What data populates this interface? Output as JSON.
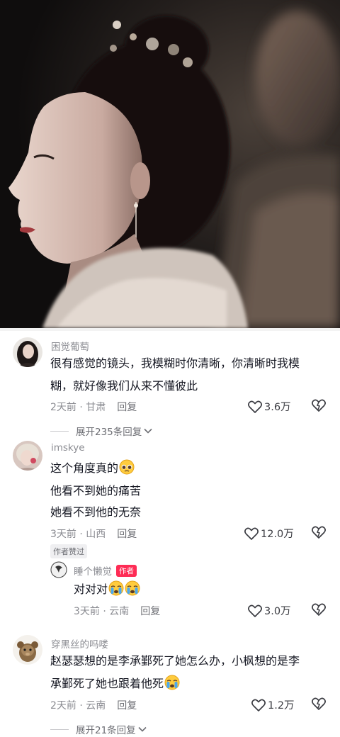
{
  "comments": [
    {
      "username": "困觉葡萄",
      "line1": "很有感觉的镜头，我模糊时你清晰，你清晰时我模",
      "line2": "糊，就好像我们从来不懂彼此",
      "time": "2天前 · 甘肃",
      "reply_label": "回复",
      "likes": "3.6万",
      "expand_label": "展开235条回复"
    },
    {
      "username": "imskye",
      "line1": "这个角度真的",
      "line2": "他看不到她的痛苦",
      "line3": "她看不到他的无奈",
      "time": "3天前 · 山西",
      "reply_label": "回复",
      "likes": "12.0万",
      "author_liked": "作者赞过"
    },
    {
      "username": "睡个懒觉",
      "author_tag": "作者",
      "text": "对对对",
      "time": "3天前 · 云南",
      "reply_label": "回复",
      "likes": "3.0万"
    },
    {
      "username": "穿黑丝的吗喽",
      "line1": "赵瑟瑟想的是李承鄞死了她怎么办，小枫想的是李",
      "line2": "承鄞死了她也跟着他死",
      "time": "2天前 · 云南",
      "reply_label": "回复",
      "likes": "1.2万",
      "expand_label": "展开21条回复"
    }
  ],
  "colors": {
    "accent": "#fe2c55",
    "muted": "#8a8b91",
    "text": "#161823"
  },
  "icons": [
    "heart-icon",
    "dislike-icon",
    "chevron-down-icon",
    "pleading-face-emoji",
    "crying-face-emoji"
  ]
}
